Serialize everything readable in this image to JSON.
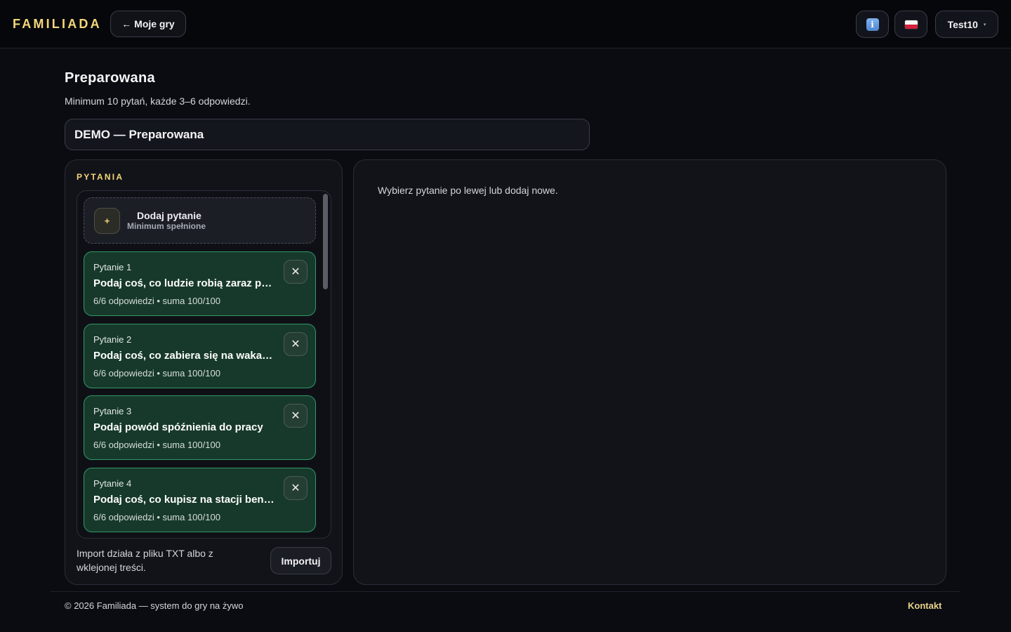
{
  "header": {
    "brand": "FAMILIADA",
    "back_label": "← Moje gry",
    "info_icon": "info-icon",
    "lang_icon": "poland-flag-icon",
    "user_name": "Test10",
    "user_caret": "▾"
  },
  "page": {
    "title": "Preparowana",
    "subtitle": "Minimum 10 pytań, każde 3–6 odpowiedzi.",
    "game_name": "DEMO — Preparowana"
  },
  "questions_panel": {
    "label": "PYTANIA",
    "add_card": {
      "plus": "+",
      "title": "Dodaj pytanie",
      "subtitle": "Minimum spełnione"
    },
    "items": [
      {
        "number": "Pytanie 1",
        "text": "Podaj coś, co ludzie robią zaraz po przebudzeniu",
        "answers": "6/6 odpowiedzi",
        "separator": "•",
        "sum": "suma 100/100"
      },
      {
        "number": "Pytanie 2",
        "text": "Podaj coś, co zabiera się na wakacje",
        "answers": "6/6 odpowiedzi",
        "separator": "•",
        "sum": "suma 100/100"
      },
      {
        "number": "Pytanie 3",
        "text": "Podaj powód spóźnienia do pracy",
        "answers": "6/6 odpowiedzi",
        "separator": "•",
        "sum": "suma 100/100"
      },
      {
        "number": "Pytanie 4",
        "text": "Podaj coś, co kupisz na stacji benzynowej",
        "answers": "6/6 odpowiedzi",
        "separator": "•",
        "sum": "suma 100/100"
      }
    ],
    "delete_glyph": "✕",
    "import_note": "Import działa z pliku TXT albo z wklejonej treści.",
    "import_label": "Importuj"
  },
  "editor_panel": {
    "hint": "Wybierz pytanie po lewej lub dodaj nowe."
  },
  "footer": {
    "copyright": "© 2026 Familiada — system do gry na żywo",
    "contact": "Kontakt"
  },
  "colors": {
    "accent": "#f4d77a",
    "card_green": "#17392c",
    "card_border": "#2f9a62",
    "background": "#0b0c12"
  }
}
